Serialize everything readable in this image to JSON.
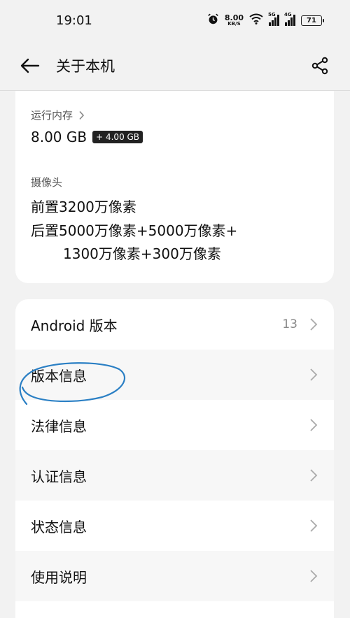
{
  "status_bar": {
    "time": "19:01",
    "net_speed_value": "8.00",
    "net_speed_unit": "KB/S",
    "sig1_tag": "5G",
    "sig2_tag": "4G",
    "battery": "71"
  },
  "header": {
    "title": "关于本机"
  },
  "memory": {
    "label": "运行内存",
    "value": "8.00 GB",
    "extra": "+ 4.00 GB"
  },
  "camera": {
    "label": "摄像头",
    "front": "前置3200万像素",
    "rear_line1": "后置5000万像素+5000万像素+",
    "rear_line2": "1300万像素+300万像素"
  },
  "list": {
    "items": [
      {
        "label": "Android 版本",
        "value": "13"
      },
      {
        "label": "版本信息"
      },
      {
        "label": "法律信息"
      },
      {
        "label": "认证信息"
      },
      {
        "label": "状态信息"
      },
      {
        "label": "使用说明"
      }
    ]
  },
  "colors": {
    "annotation": "#2a7fc4",
    "background": "#f2f2f2",
    "card": "#ffffff"
  }
}
